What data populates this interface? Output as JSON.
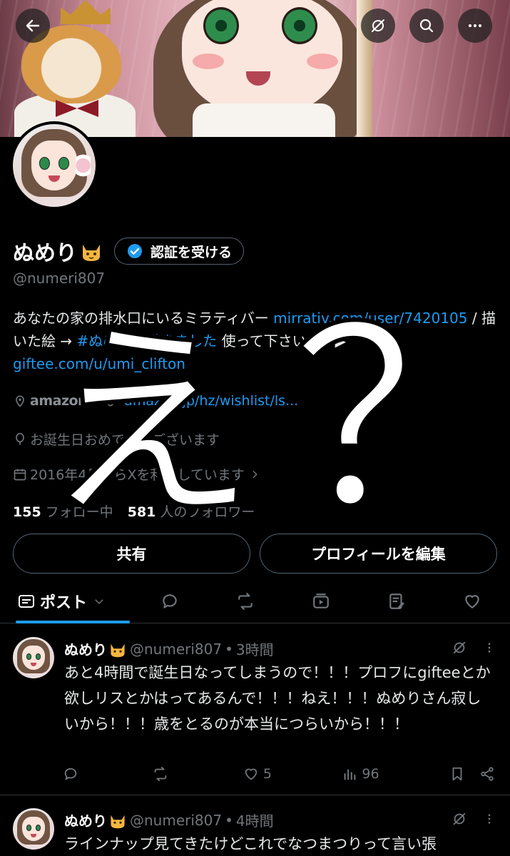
{
  "header": {
    "back_icon": "arrow-left-icon",
    "grok_icon": "grok-icon",
    "search_icon": "search-icon",
    "more_icon": "more-horizontal-icon"
  },
  "profile": {
    "display_name": "ぬめり",
    "handle": "@numeri807",
    "verify_label": "認証を受ける",
    "bio_text_1": "あなたの家の排水口にいるミラティバー ",
    "bio_link_1": "mirrativ.com/user/7420105",
    "bio_text_2": " / 描いた絵 → ",
    "bio_hashtag": "#ぬめりが描きました",
    "bio_text_3": " 使って下さいなっ▶",
    "bio_link_2": "giftee.com/u/umi_clifton",
    "website_prefix": "amazon▶",
    "website_link": "amazon.jp/hz/wishlist/ls...",
    "location": "お誕生日おめでとうございます",
    "joined": "2016年4月からXを利用しています",
    "following_count": "155",
    "following_label": "フォロー中",
    "followers_count": "581",
    "followers_label": "人のフォロワー",
    "share_label": "共有",
    "edit_label": "プロフィールを編集"
  },
  "tabs": {
    "posts_label": "ポスト"
  },
  "posts": [
    {
      "name": "ぬめり",
      "handle": "@numeri807",
      "time": "3時間",
      "body": "あと4時間で誕生日なってしまうので！！！プロフにgifteeとか欲しリスとかはってあるんで！！！ねえ！！！ぬめりさん寂しいから！！！歳をとるのが本当につらいから！！！",
      "likes": "5",
      "views": "96"
    },
    {
      "name": "ぬめり",
      "handle": "@numeri807",
      "time": "4時間",
      "body": "ラインナップ見てきたけどこれでなつまつりって言い張"
    }
  ],
  "overlay": {
    "big_char": "え",
    "question": "？"
  },
  "colors": {
    "accent": "#1d9bf0",
    "muted": "#71767b",
    "border": "#2f3336"
  }
}
